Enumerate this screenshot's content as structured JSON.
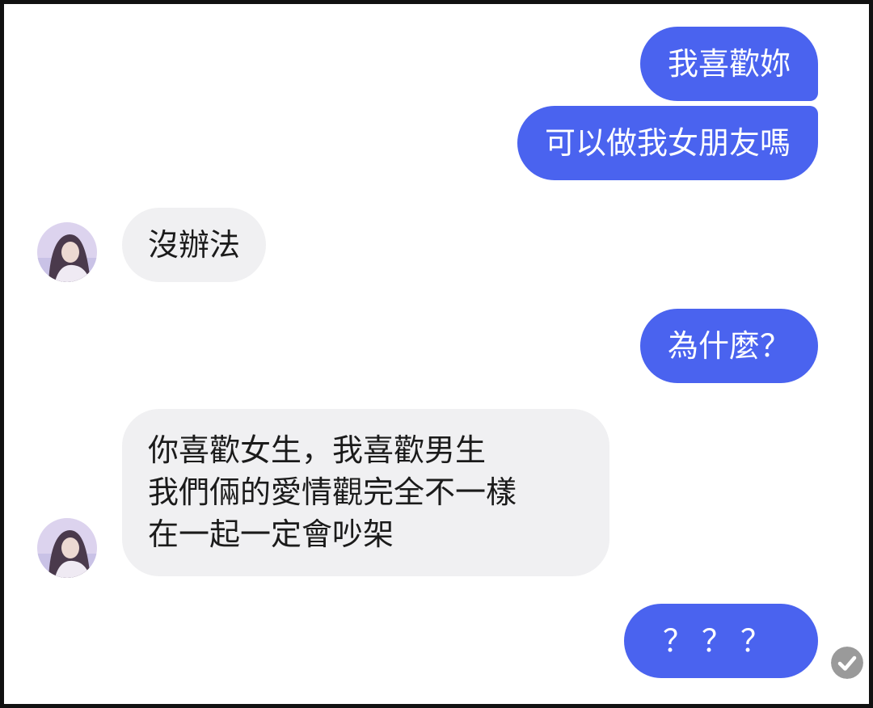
{
  "conversation": {
    "messages": [
      {
        "sender": "me",
        "text": "我喜歡妳"
      },
      {
        "sender": "me",
        "text": "可以做我女朋友嗎"
      },
      {
        "sender": "them",
        "text": "沒辦法"
      },
      {
        "sender": "me",
        "text": "為什麼？"
      },
      {
        "sender": "them",
        "lines": [
          "你喜歡女生，我喜歡男生",
          "我們倆的愛情觀完全不一樣",
          "在一起一定會吵架"
        ]
      },
      {
        "sender": "me",
        "text": "？？？"
      }
    ]
  },
  "contact": {
    "avatar_icon": "user-avatar-icon"
  },
  "status": {
    "seen_icon": "check-circle-icon"
  },
  "colors": {
    "outgoing_bubble": "#4a63ef",
    "incoming_bubble": "#f0f0f2",
    "seen_indicator": "#9a9a9a"
  }
}
